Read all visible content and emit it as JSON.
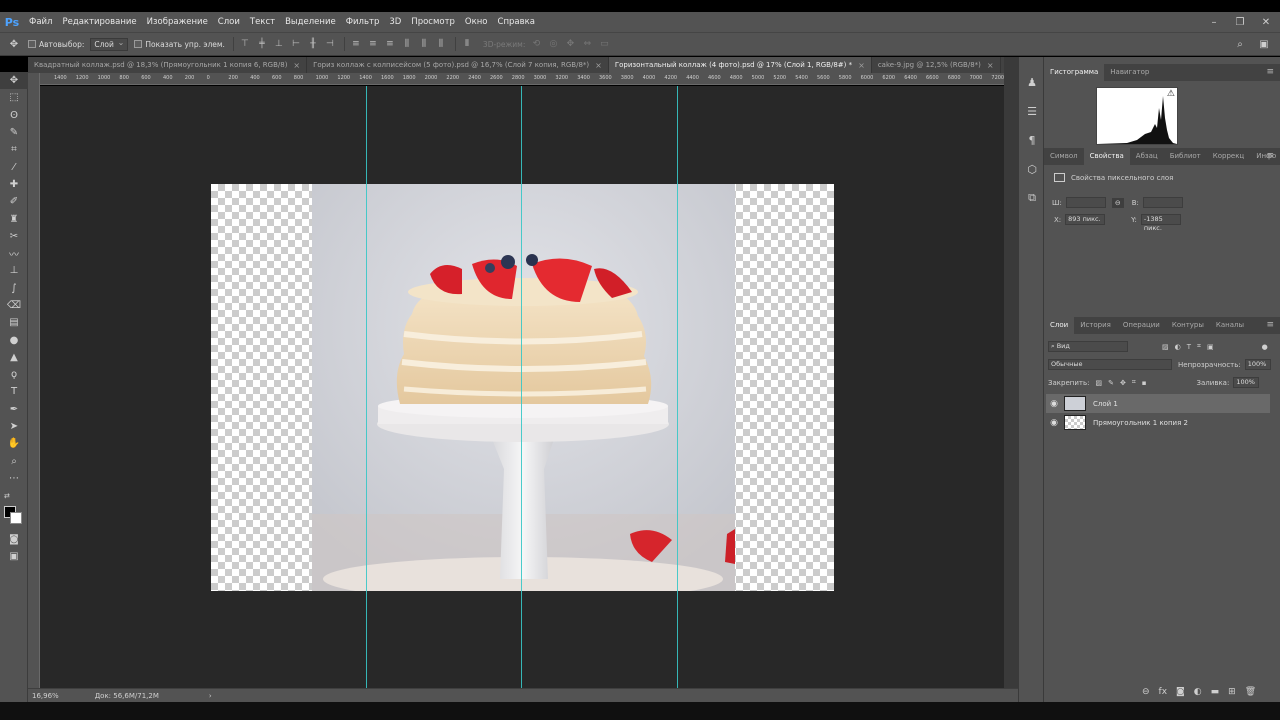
{
  "app": {
    "logo": "Ps"
  },
  "menu": [
    "Файл",
    "Редактирование",
    "Изображение",
    "Слои",
    "Текст",
    "Выделение",
    "Фильтр",
    "3D",
    "Просмотр",
    "Окно",
    "Справка"
  ],
  "window_controls": [
    "–",
    "❐",
    "✕"
  ],
  "options": {
    "autoselect_label": "Автовыбор:",
    "autoselect_value": "Слой",
    "show_controls_label": "Показать упр. элем.",
    "mode_3d": "3D-режим:"
  },
  "tabs": [
    {
      "label": "Квадратный коллаж.psd @ 18,3% (Прямоугольник 1 копия 6, RGB/8)",
      "active": false
    },
    {
      "label": "Гориз коллаж с колписейсом (5 фото).psd @ 16,7% (Слой 7 копия, RGB/8*)",
      "active": false
    },
    {
      "label": "Горизонтальный коллаж (4 фото).psd @ 17% (Слой 1, RGB/8#) *",
      "active": true
    },
    {
      "label": "cake-9.jpg @ 12,5% (RGB/8*)",
      "active": false
    }
  ],
  "ruler_ticks": [
    "1400",
    "1200",
    "1000",
    "800",
    "600",
    "400",
    "200",
    "0",
    "200",
    "400",
    "600",
    "800",
    "1000",
    "1200",
    "1400",
    "1600",
    "1800",
    "2000",
    "2200",
    "2400",
    "2600",
    "2800",
    "3000",
    "3200",
    "3400",
    "3600",
    "3800",
    "4000",
    "4200",
    "4400",
    "4600",
    "4800",
    "5000",
    "5200",
    "5400",
    "5600",
    "5800",
    "6000",
    "6200",
    "6400",
    "6600",
    "6800",
    "7000",
    "7200"
  ],
  "status": {
    "zoom": "16,96%",
    "doc": "Док: 56,6M/71,2M",
    "arrow": "›"
  },
  "panels": {
    "top_tabs": [
      "Гистограмма",
      "Навигатор"
    ],
    "warning": "⚠",
    "prop_tabs": [
      "Символ",
      "Свойства",
      "Абзац",
      "Библиот",
      "Коррекц",
      "Инфо"
    ],
    "prop_title": "Свойства пиксельного слоя",
    "w_label": "Ш:",
    "h_label": "В:",
    "link": "⊖",
    "x_label": "X:",
    "x_value": "893 пикс.",
    "y_label": "Y:",
    "y_value": "-1385 пикс.",
    "layer_tabs": [
      "Слои",
      "История",
      "Операции",
      "Контуры",
      "Каналы"
    ],
    "filter_label": "Вид",
    "blend_mode": "Обычные",
    "opacity_label": "Непрозрачность:",
    "opacity_value": "100%",
    "lock_label": "Закрепить:",
    "fill_label": "Заливка:",
    "fill_value": "100%",
    "layers": [
      {
        "name": "Слой 1",
        "selected": true
      },
      {
        "name": "Прямоугольник 1 копия 2",
        "selected": false
      }
    ]
  }
}
